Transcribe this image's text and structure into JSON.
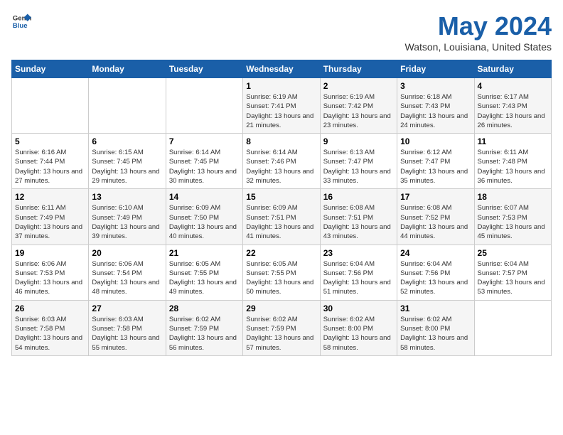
{
  "header": {
    "logo_general": "General",
    "logo_blue": "Blue",
    "month": "May 2024",
    "location": "Watson, Louisiana, United States"
  },
  "days_of_week": [
    "Sunday",
    "Monday",
    "Tuesday",
    "Wednesday",
    "Thursday",
    "Friday",
    "Saturday"
  ],
  "weeks": [
    [
      {
        "day": "",
        "info": ""
      },
      {
        "day": "",
        "info": ""
      },
      {
        "day": "",
        "info": ""
      },
      {
        "day": "1",
        "info": "Sunrise: 6:19 AM\nSunset: 7:41 PM\nDaylight: 13 hours and 21 minutes."
      },
      {
        "day": "2",
        "info": "Sunrise: 6:19 AM\nSunset: 7:42 PM\nDaylight: 13 hours and 23 minutes."
      },
      {
        "day": "3",
        "info": "Sunrise: 6:18 AM\nSunset: 7:43 PM\nDaylight: 13 hours and 24 minutes."
      },
      {
        "day": "4",
        "info": "Sunrise: 6:17 AM\nSunset: 7:43 PM\nDaylight: 13 hours and 26 minutes."
      }
    ],
    [
      {
        "day": "5",
        "info": "Sunrise: 6:16 AM\nSunset: 7:44 PM\nDaylight: 13 hours and 27 minutes."
      },
      {
        "day": "6",
        "info": "Sunrise: 6:15 AM\nSunset: 7:45 PM\nDaylight: 13 hours and 29 minutes."
      },
      {
        "day": "7",
        "info": "Sunrise: 6:14 AM\nSunset: 7:45 PM\nDaylight: 13 hours and 30 minutes."
      },
      {
        "day": "8",
        "info": "Sunrise: 6:14 AM\nSunset: 7:46 PM\nDaylight: 13 hours and 32 minutes."
      },
      {
        "day": "9",
        "info": "Sunrise: 6:13 AM\nSunset: 7:47 PM\nDaylight: 13 hours and 33 minutes."
      },
      {
        "day": "10",
        "info": "Sunrise: 6:12 AM\nSunset: 7:47 PM\nDaylight: 13 hours and 35 minutes."
      },
      {
        "day": "11",
        "info": "Sunrise: 6:11 AM\nSunset: 7:48 PM\nDaylight: 13 hours and 36 minutes."
      }
    ],
    [
      {
        "day": "12",
        "info": "Sunrise: 6:11 AM\nSunset: 7:49 PM\nDaylight: 13 hours and 37 minutes."
      },
      {
        "day": "13",
        "info": "Sunrise: 6:10 AM\nSunset: 7:49 PM\nDaylight: 13 hours and 39 minutes."
      },
      {
        "day": "14",
        "info": "Sunrise: 6:09 AM\nSunset: 7:50 PM\nDaylight: 13 hours and 40 minutes."
      },
      {
        "day": "15",
        "info": "Sunrise: 6:09 AM\nSunset: 7:51 PM\nDaylight: 13 hours and 41 minutes."
      },
      {
        "day": "16",
        "info": "Sunrise: 6:08 AM\nSunset: 7:51 PM\nDaylight: 13 hours and 43 minutes."
      },
      {
        "day": "17",
        "info": "Sunrise: 6:08 AM\nSunset: 7:52 PM\nDaylight: 13 hours and 44 minutes."
      },
      {
        "day": "18",
        "info": "Sunrise: 6:07 AM\nSunset: 7:53 PM\nDaylight: 13 hours and 45 minutes."
      }
    ],
    [
      {
        "day": "19",
        "info": "Sunrise: 6:06 AM\nSunset: 7:53 PM\nDaylight: 13 hours and 46 minutes."
      },
      {
        "day": "20",
        "info": "Sunrise: 6:06 AM\nSunset: 7:54 PM\nDaylight: 13 hours and 48 minutes."
      },
      {
        "day": "21",
        "info": "Sunrise: 6:05 AM\nSunset: 7:55 PM\nDaylight: 13 hours and 49 minutes."
      },
      {
        "day": "22",
        "info": "Sunrise: 6:05 AM\nSunset: 7:55 PM\nDaylight: 13 hours and 50 minutes."
      },
      {
        "day": "23",
        "info": "Sunrise: 6:04 AM\nSunset: 7:56 PM\nDaylight: 13 hours and 51 minutes."
      },
      {
        "day": "24",
        "info": "Sunrise: 6:04 AM\nSunset: 7:56 PM\nDaylight: 13 hours and 52 minutes."
      },
      {
        "day": "25",
        "info": "Sunrise: 6:04 AM\nSunset: 7:57 PM\nDaylight: 13 hours and 53 minutes."
      }
    ],
    [
      {
        "day": "26",
        "info": "Sunrise: 6:03 AM\nSunset: 7:58 PM\nDaylight: 13 hours and 54 minutes."
      },
      {
        "day": "27",
        "info": "Sunrise: 6:03 AM\nSunset: 7:58 PM\nDaylight: 13 hours and 55 minutes."
      },
      {
        "day": "28",
        "info": "Sunrise: 6:02 AM\nSunset: 7:59 PM\nDaylight: 13 hours and 56 minutes."
      },
      {
        "day": "29",
        "info": "Sunrise: 6:02 AM\nSunset: 7:59 PM\nDaylight: 13 hours and 57 minutes."
      },
      {
        "day": "30",
        "info": "Sunrise: 6:02 AM\nSunset: 8:00 PM\nDaylight: 13 hours and 58 minutes."
      },
      {
        "day": "31",
        "info": "Sunrise: 6:02 AM\nSunset: 8:00 PM\nDaylight: 13 hours and 58 minutes."
      },
      {
        "day": "",
        "info": ""
      }
    ]
  ]
}
